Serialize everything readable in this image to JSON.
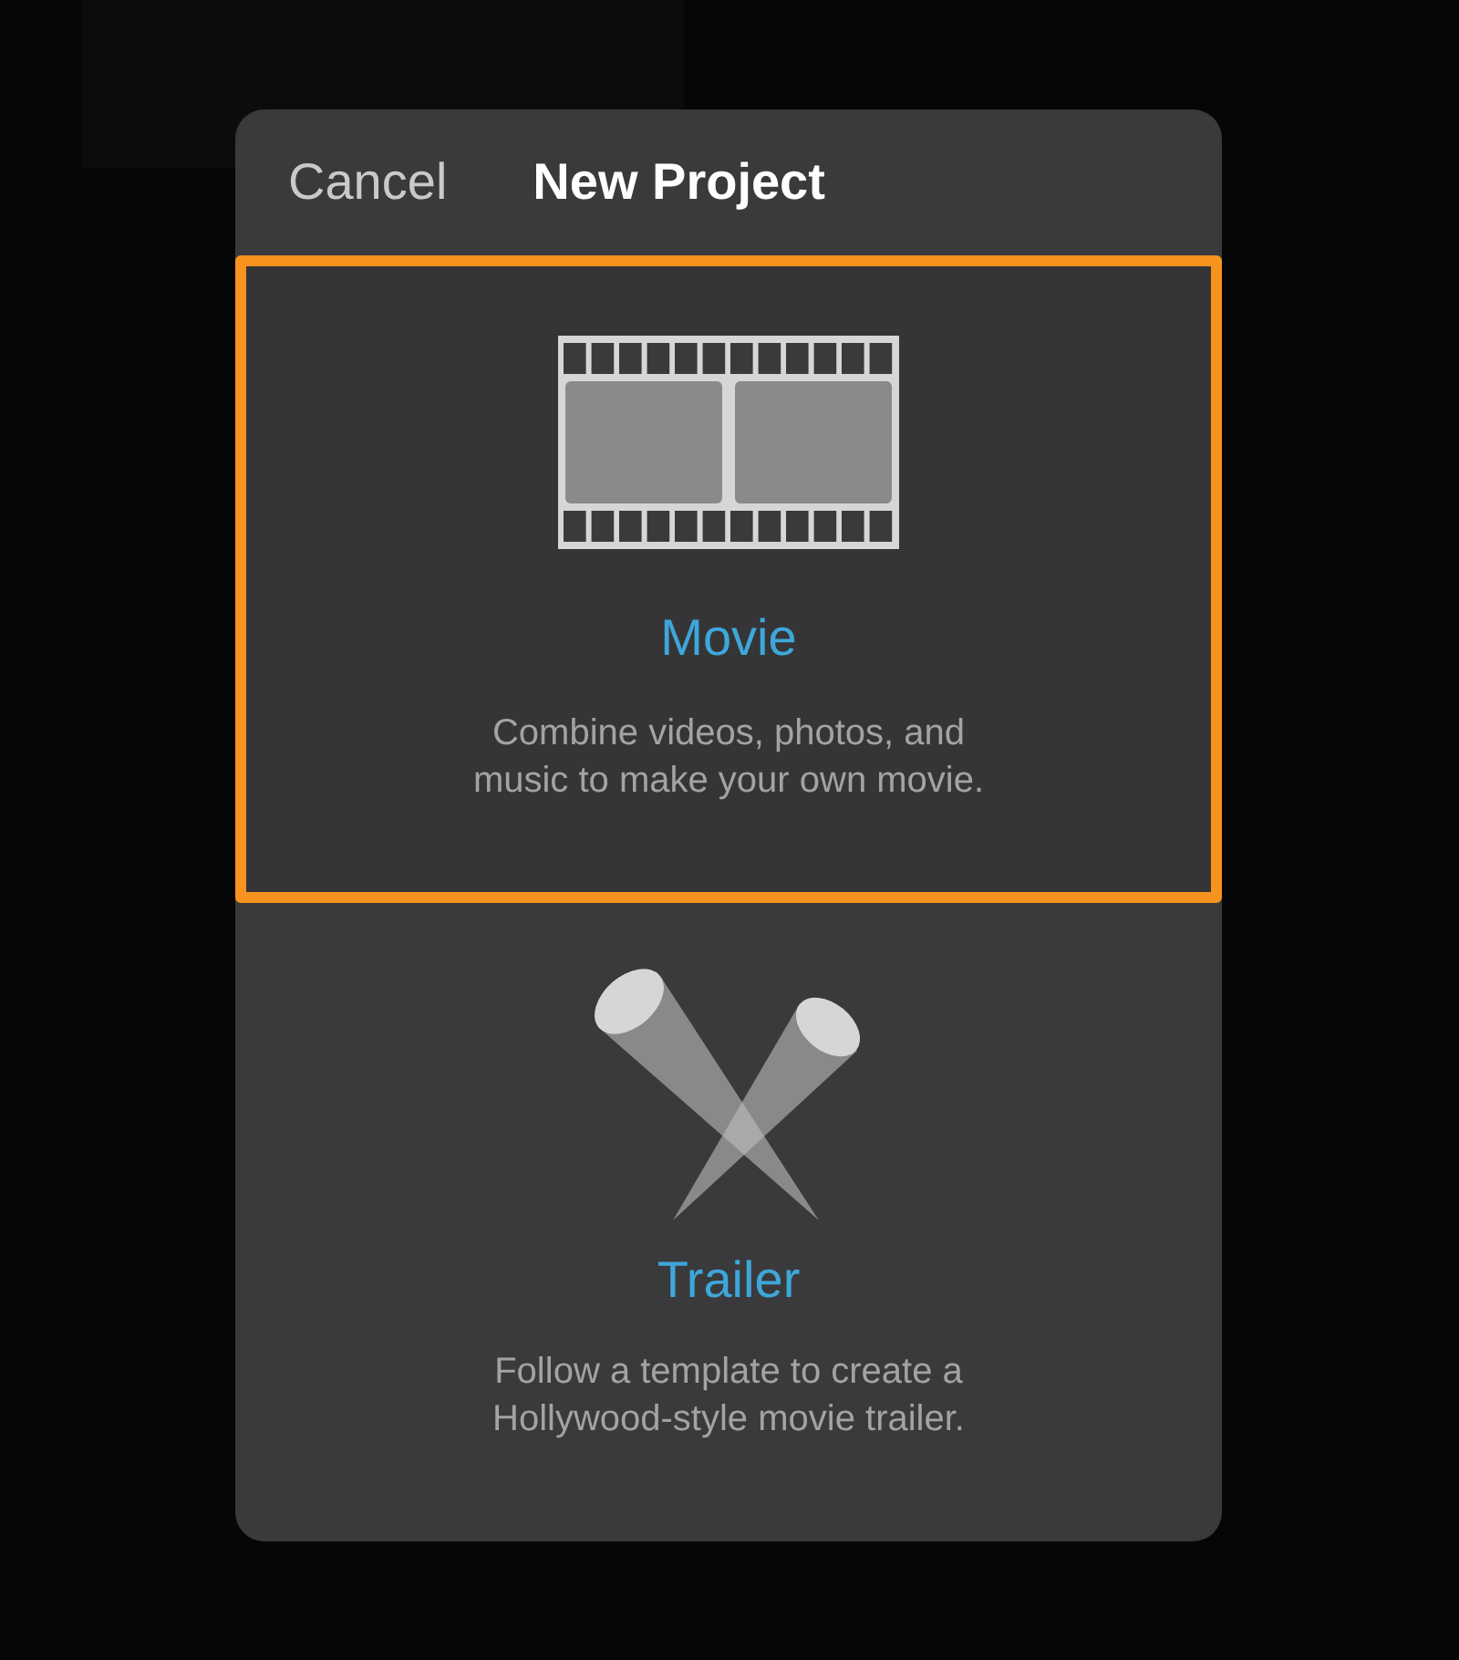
{
  "dialog": {
    "cancel": "Cancel",
    "title": "New Project"
  },
  "options": [
    {
      "kind": "movie",
      "title": "Movie",
      "description": "Combine videos, photos, and music to make your own movie.",
      "selected": true
    },
    {
      "kind": "trailer",
      "title": "Trailer",
      "description": "Follow a template to create a Hollywood-style movie trailer.",
      "selected": false
    }
  ]
}
